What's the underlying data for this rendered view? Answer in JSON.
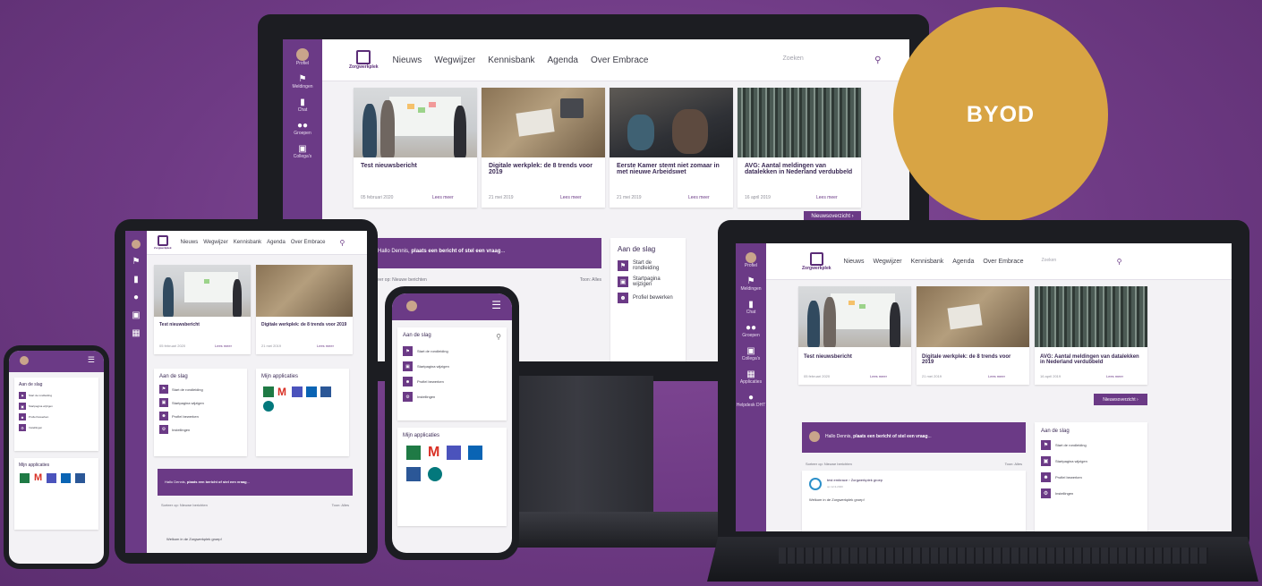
{
  "brand": {
    "name": "Zorgwerkplek",
    "accent": "#6b3a86",
    "badge": "BYOD",
    "badge_color": "#d8a444"
  },
  "nav": [
    "Nieuws",
    "Wegwijzer",
    "Kennisbank",
    "Agenda",
    "Over Embrace"
  ],
  "search_placeholder": "Zoeken",
  "rail": [
    {
      "label": "Profiel",
      "icon": "avatar-icon"
    },
    {
      "label": "Meldingen",
      "icon": "bell-icon"
    },
    {
      "label": "Chat",
      "icon": "chat-icon"
    },
    {
      "label": "Groepen",
      "icon": "group-icon"
    },
    {
      "label": "Collega's",
      "icon": "contacts-icon"
    },
    {
      "label": "Applicaties",
      "icon": "grid-icon"
    },
    {
      "label": "Helpdesk DHT",
      "icon": "help-icon"
    }
  ],
  "news": [
    {
      "title": "Test nieuwsbericht",
      "date": "05 februari 2020",
      "more": "Lees meer"
    },
    {
      "title": "Digitale werkplek: de 8 trends voor 2019",
      "date": "21 mei 2019",
      "more": "Lees meer"
    },
    {
      "title": "Eerste Kamer stemt niet zomaar in met nieuwe Arbeidswet",
      "date": "21 mei 2019",
      "more": "Lees meer"
    },
    {
      "title": "AVG: Aantal meldingen van datalekken in Nederland verdubbeld",
      "date": "16 april 2019",
      "more": "Lees meer"
    }
  ],
  "news_overview": "Nieuwsoverzicht",
  "post_prompt_prefix": "Hallo Dennis, ",
  "post_prompt_bold": "plaats een bericht of stel een vraag",
  "post_prompt_suffix": "...",
  "feed": {
    "sort_label": "Sorteer op: Nieuwe berichten",
    "filter_label": "Toon: Alles",
    "author": "test embrace",
    "group": "Zorgwerkplek groep",
    "time": "op 12-3-2020",
    "message": "Welkom in de Zorgwerkplek groep!"
  },
  "getting_started": {
    "title": "Aan de slag",
    "items": [
      "Start de rondleiding",
      "Startpagina wijzigen",
      "Profiel bewerken",
      "Instellingen"
    ]
  },
  "apps": {
    "title": "Mijn applicaties"
  }
}
